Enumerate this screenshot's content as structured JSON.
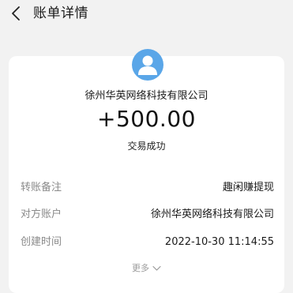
{
  "header": {
    "title": "账单详情"
  },
  "bill": {
    "payee": "徐州华英网络科技有限公司",
    "amount": "+500.00",
    "status": "交易成功"
  },
  "details": [
    {
      "label": "转账备注",
      "value": "趣闲赚提现"
    },
    {
      "label": "对方账户",
      "value": "徐州华英网络科技有限公司"
    },
    {
      "label": "创建时间",
      "value": "2022-10-30 11:14:55"
    }
  ],
  "more_label": "更多",
  "colors": {
    "avatar": "#5aa6e8",
    "background": "#f2f2f2",
    "card": "#ffffff"
  },
  "icons": {
    "back": "chevron-left-icon",
    "avatar": "user-icon",
    "more": "chevron-down-icon"
  }
}
